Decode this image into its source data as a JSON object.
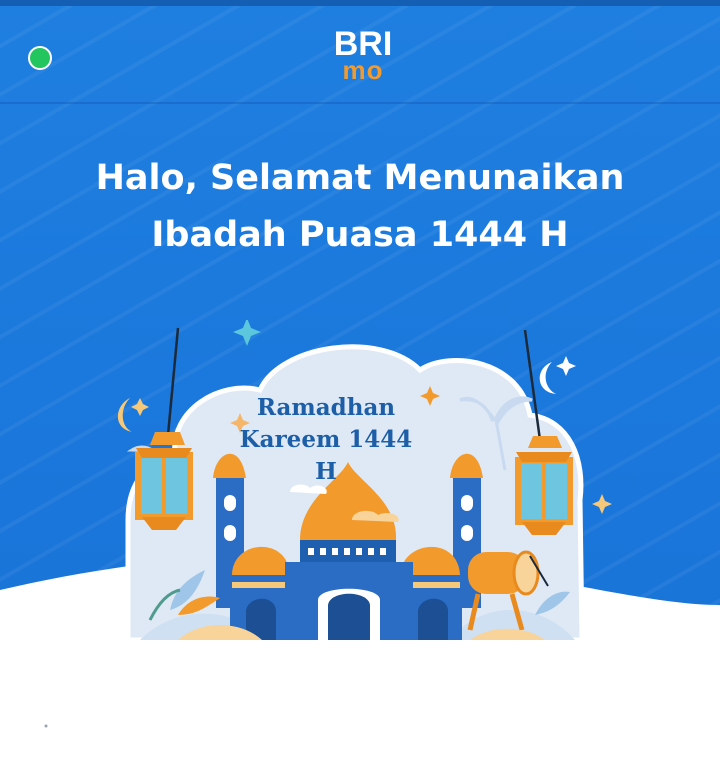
{
  "header": {
    "logo_main": "BRI",
    "logo_sub": "mo"
  },
  "hero": {
    "greeting_line1": "Halo, Selamat Menunaikan",
    "greeting_line2": "Ibadah Puasa 1444 H",
    "banner_line1": "Ramadhan",
    "banner_line2": "Kareem 1444 H"
  },
  "colors": {
    "primary_blue": "#1b78dc",
    "logo_orange": "#f39a2d",
    "status_green": "#22c55e",
    "text_white": "#ffffff"
  }
}
